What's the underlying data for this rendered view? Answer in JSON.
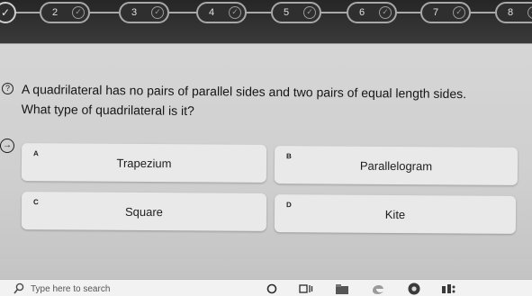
{
  "stepper": {
    "steps": [
      {
        "label": "2"
      },
      {
        "label": "3"
      },
      {
        "label": "4"
      },
      {
        "label": "5"
      },
      {
        "label": "6"
      },
      {
        "label": "7"
      },
      {
        "label": "8"
      }
    ],
    "check_glyph": "✓",
    "first_step_glyph": "✓"
  },
  "question": {
    "icon_glyph": "?",
    "text_line1": "A quadrilateral has no pairs of parallel sides and two pairs of equal length sides.",
    "text_line2": "What type of quadrilateral is it?"
  },
  "answers": [
    {
      "letter": "A",
      "label": "Trapezium"
    },
    {
      "letter": "B",
      "label": "Parallelogram"
    },
    {
      "letter": "C",
      "label": "Square"
    },
    {
      "letter": "D",
      "label": "Kite"
    }
  ],
  "side_icon_glyph": "→",
  "taskbar": {
    "search_placeholder": "Type here to search",
    "icons": [
      "search-icon",
      "circle-icon",
      "task-view-icon",
      "file-explorer-icon",
      "edge-icon",
      "chrome-icon",
      "network-icon"
    ]
  }
}
